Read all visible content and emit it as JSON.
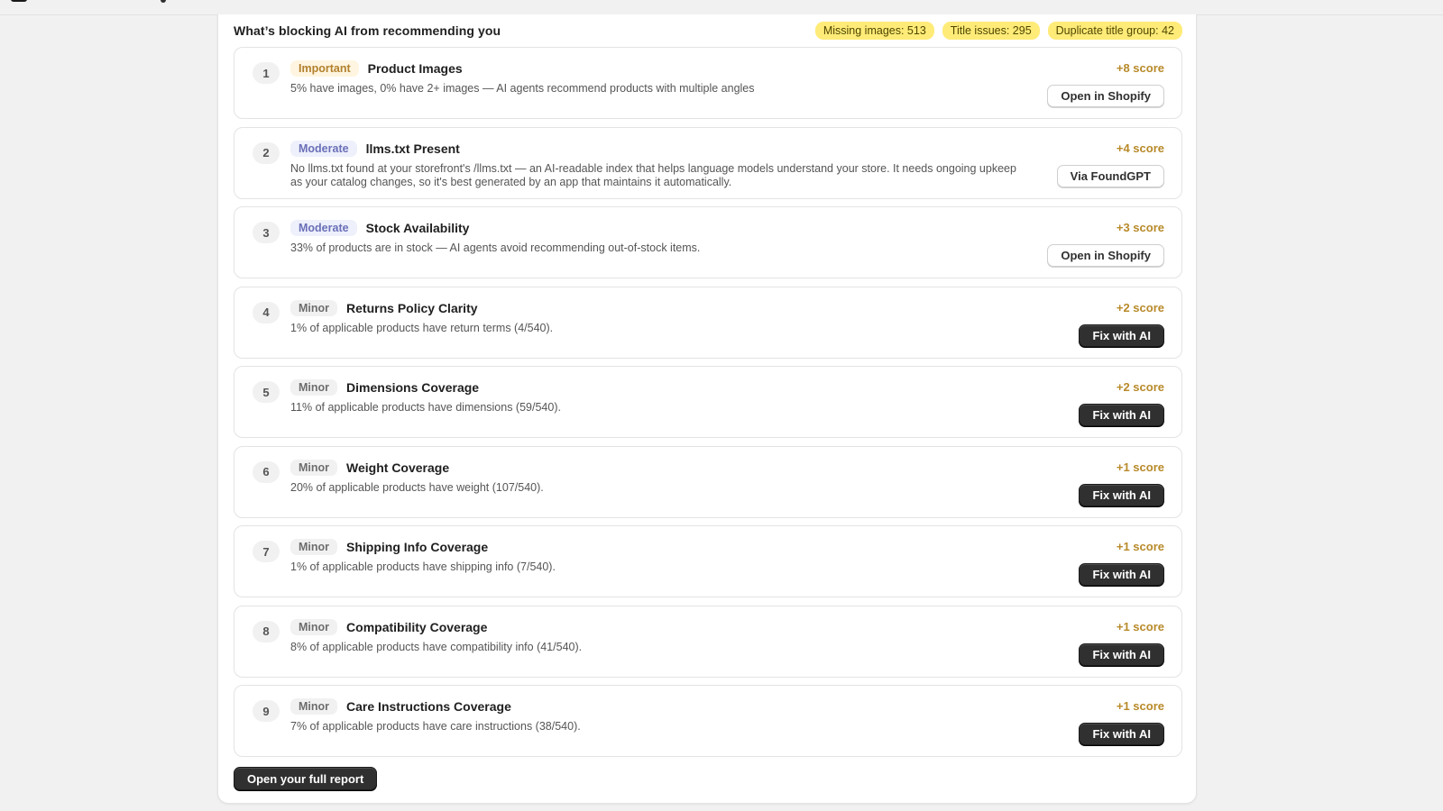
{
  "header": {
    "title": "What’s blocking AI from recommending you",
    "chips": [
      "Missing images: 513",
      "Title issues: 295",
      "Duplicate title group: 42"
    ]
  },
  "colors": {
    "chip_bg": "#ffeb78",
    "score": "#b88a2a",
    "important": "#b2802d",
    "moderate": "#6a6fb8",
    "minor": "#6d6d6d",
    "dark_button": "#303030"
  },
  "items": [
    {
      "num": "1",
      "severity": "Important",
      "severity_type": "important",
      "title": "Product Images",
      "description": "5% have images, 0% have 2+ images — AI agents recommend products with multiple angles",
      "score": "+8 score",
      "button": "Open in Shopify",
      "button_style": "outline"
    },
    {
      "num": "2",
      "severity": "Moderate",
      "severity_type": "moderate",
      "title": "llms.txt Present",
      "description": "No llms.txt found at your storefront's /llms.txt — an AI-readable index that helps language models understand your store. It needs ongoing upkeep as your catalog changes, so it's best generated by an app that maintains it automatically.",
      "score": "+4 score",
      "button": "Via FoundGPT",
      "button_style": "outline"
    },
    {
      "num": "3",
      "severity": "Moderate",
      "severity_type": "moderate",
      "title": "Stock Availability",
      "description": "33% of products are in stock — AI agents avoid recommending out-of-stock items.",
      "score": "+3 score",
      "button": "Open in Shopify",
      "button_style": "outline"
    },
    {
      "num": "4",
      "severity": "Minor",
      "severity_type": "minor",
      "title": "Returns Policy Clarity",
      "description": "1% of applicable products have return terms (4/540).",
      "score": "+2 score",
      "button": "Fix with AI",
      "button_style": "dark"
    },
    {
      "num": "5",
      "severity": "Minor",
      "severity_type": "minor",
      "title": "Dimensions Coverage",
      "description": "11% of applicable products have dimensions (59/540).",
      "score": "+2 score",
      "button": "Fix with AI",
      "button_style": "dark"
    },
    {
      "num": "6",
      "severity": "Minor",
      "severity_type": "minor",
      "title": "Weight Coverage",
      "description": "20% of applicable products have weight (107/540).",
      "score": "+1 score",
      "button": "Fix with AI",
      "button_style": "dark"
    },
    {
      "num": "7",
      "severity": "Minor",
      "severity_type": "minor",
      "title": "Shipping Info Coverage",
      "description": "1% of applicable products have shipping info (7/540).",
      "score": "+1 score",
      "button": "Fix with AI",
      "button_style": "dark"
    },
    {
      "num": "8",
      "severity": "Minor",
      "severity_type": "minor",
      "title": "Compatibility Coverage",
      "description": "8% of applicable products have compatibility info (41/540).",
      "score": "+1 score",
      "button": "Fix with AI",
      "button_style": "dark"
    },
    {
      "num": "9",
      "severity": "Minor",
      "severity_type": "minor",
      "title": "Care Instructions Coverage",
      "description": "7% of applicable products have care instructions (38/540).",
      "score": "+1 score",
      "button": "Fix with AI",
      "button_style": "dark"
    }
  ],
  "footer": {
    "button": "Open your full report"
  }
}
